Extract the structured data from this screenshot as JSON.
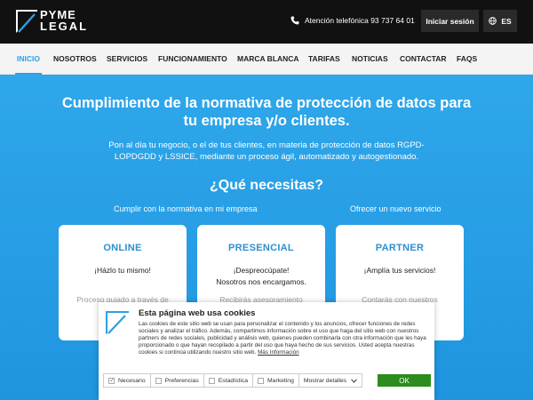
{
  "header": {
    "logo_top": "PYME",
    "logo_bottom": "LEGAL",
    "phone_text": "Atención telefónica 93 737 64 01",
    "login_label": "Iniciar sesión",
    "lang_label": "ES"
  },
  "nav": {
    "items": [
      {
        "label": "INICIO",
        "active": true
      },
      {
        "label": "NOSOTROS"
      },
      {
        "label": "SERVICIOS"
      },
      {
        "label": "FUNCIONAMIENTO"
      },
      {
        "label": "MARCA BLANCA"
      },
      {
        "label": "TARIFAS"
      },
      {
        "label": "NOTICIAS"
      },
      {
        "label": "CONTACTAR"
      },
      {
        "label": "FAQS"
      }
    ]
  },
  "hero": {
    "title": "Cumplimiento de la normativa de protección de datos para tu empresa y/o clientes.",
    "description": "Pon al día tu negocio, o el de tus clientes, en materia de protección de datos RGPD-LOPDGDD y LSSICE, mediante un proceso ágil, automatizado y autogestionado.",
    "question": "¿Qué necesitas?",
    "sub_left": "Cumplir con la normativa en mi empresa",
    "sub_right": "Ofrecer un nuevo servicio"
  },
  "cards": [
    {
      "title": "ONLINE",
      "subtitle": "¡Házlo tu mismo!",
      "body": "Proceso guiado a través de"
    },
    {
      "title": "PRESENCIAL",
      "subtitle": "¡Despreocúpate!\nNosotros nos encargamos.",
      "body": "Recibirás asesoramiento"
    },
    {
      "title": "PARTNER",
      "subtitle": "¡Amplía tus servicios!",
      "body": "Contarás con nuestros"
    }
  ],
  "cookie": {
    "title": "Esta página web usa cookies",
    "text": "Las cookies de este sitio web se usan para personalizar el contenido y los anuncios, ofrecer funciones de redes sociales y analizar el tráfico. Además, compartimos información sobre el uso que haga del sitio web con nuestros partners de redes sociales, publicidad y análisis web, quienes pueden combinarla con otra información que les haya proporcionado o que hayan recopilado a partir del uso que haya hecho de sus servicios. Usted acepta nuestras cookies si continúa utilizando nuestro sitio web.",
    "link": "Más Información",
    "options": [
      {
        "label": "Necesario",
        "checked": true
      },
      {
        "label": "Preferencias",
        "checked": false
      },
      {
        "label": "Estadística",
        "checked": false
      },
      {
        "label": "Marketing",
        "checked": false
      }
    ],
    "details_label": "Mostrar detalles",
    "ok_label": "OK"
  },
  "colors": {
    "topbar": "#111111",
    "accent": "#2d9fe6",
    "hero": "#2fa7ea",
    "ok_button": "#2d8c1e"
  }
}
